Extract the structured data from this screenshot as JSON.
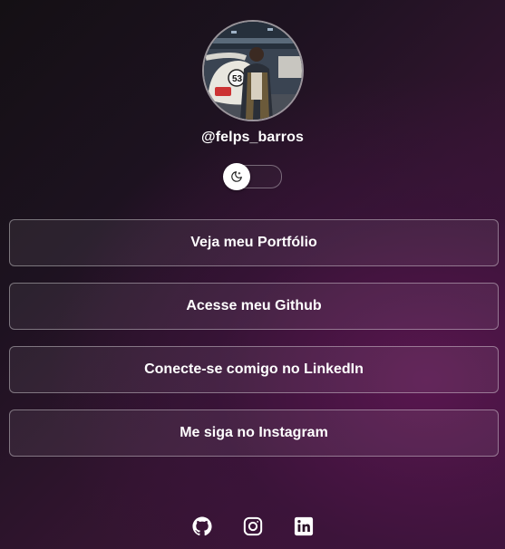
{
  "profile": {
    "username": "@felps_barros",
    "avatar_icon": "profile-photo"
  },
  "theme_toggle": {
    "icon": "moon-icon",
    "state": "dark"
  },
  "links": [
    {
      "label": "Veja meu Portfólio"
    },
    {
      "label": "Acesse meu Github"
    },
    {
      "label": "Conecte-se comigo no LinkedIn"
    },
    {
      "label": "Me siga no Instagram"
    }
  ],
  "socials": [
    {
      "icon": "github-icon"
    },
    {
      "icon": "instagram-icon"
    },
    {
      "icon": "linkedin-icon"
    }
  ],
  "colors": {
    "background_dark": "#141014",
    "background_accent": "#45173f",
    "text": "#ffffff"
  }
}
